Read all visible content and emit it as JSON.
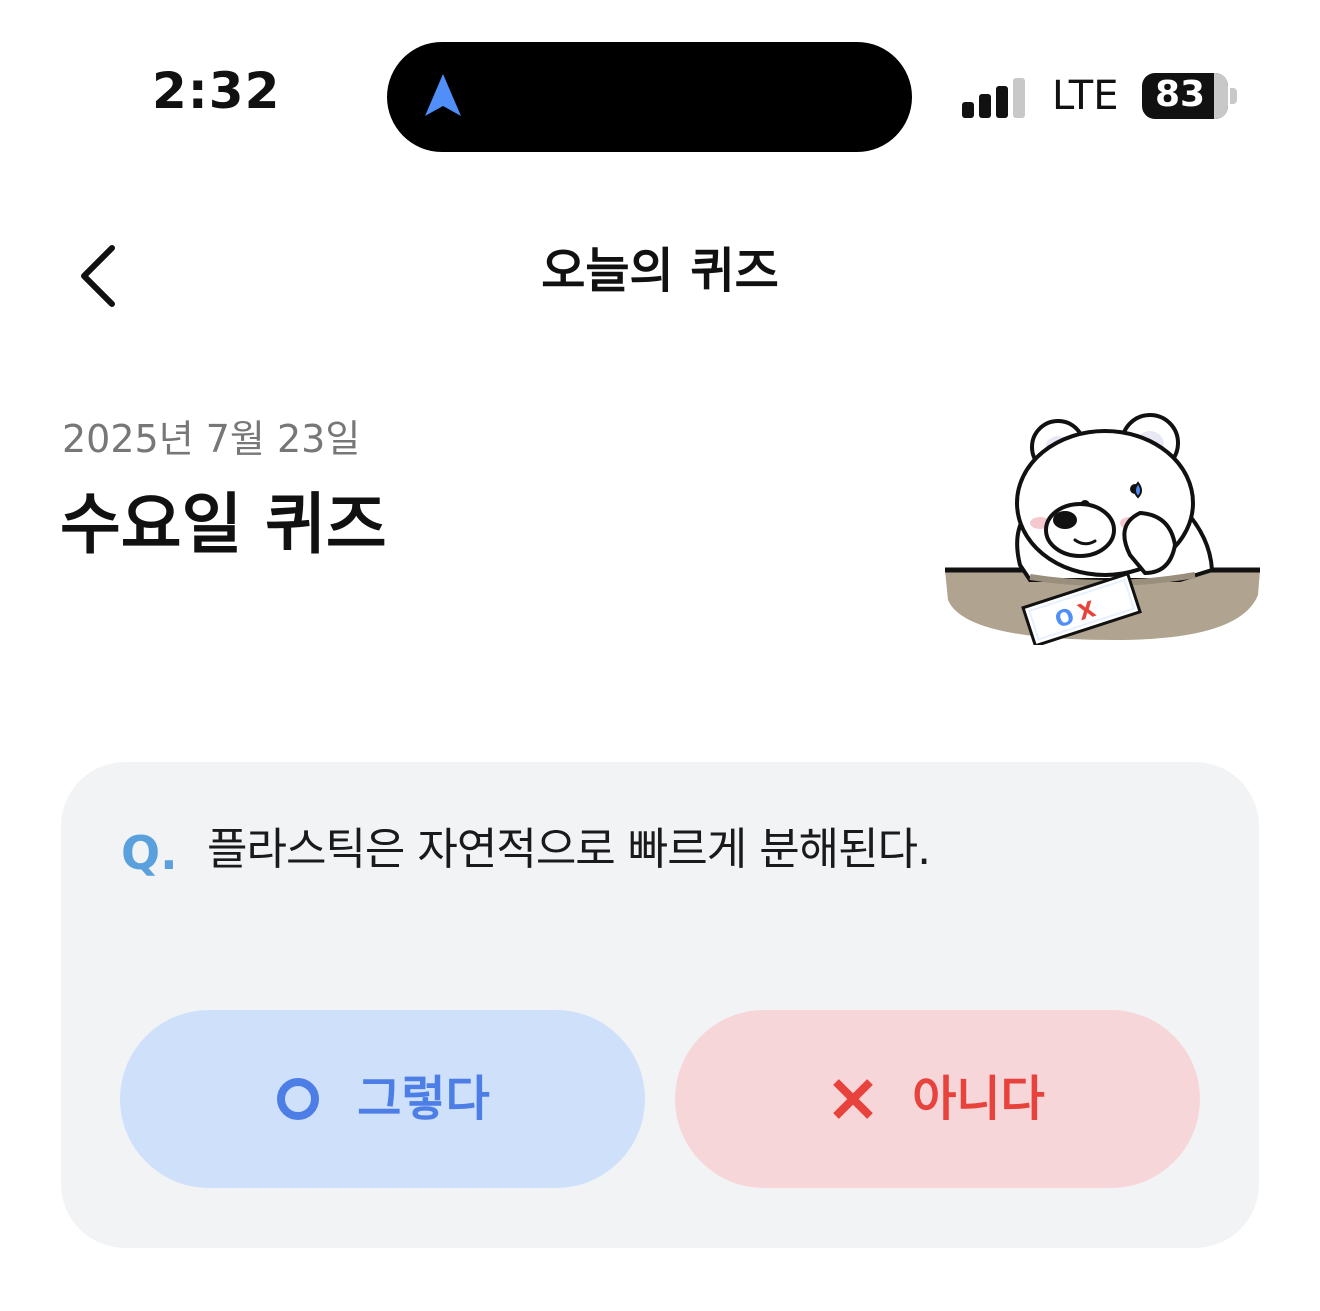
{
  "status_bar": {
    "time": "2:32",
    "network": "LTE",
    "battery": "83",
    "nav_icon": "location-arrow-icon"
  },
  "header": {
    "title": "오늘의 퀴즈",
    "back_icon": "chevron-left-icon"
  },
  "quiz": {
    "date": "2025년 7월 23일",
    "title": "수요일 퀴즈",
    "question_prefix": "Q.",
    "question": "플라스틱은 자연적으로 빠르게 분해된다.",
    "answers": [
      {
        "label": "그렇다",
        "icon": "circle-o-icon",
        "color": "#4d7ee6"
      },
      {
        "label": "아니다",
        "icon": "x-mark-icon",
        "color": "#e8423d"
      }
    ],
    "paper_text": "OX"
  },
  "colors": {
    "yes_bg": "#cfe0fb",
    "no_bg": "#f7d6da",
    "card_bg": "#f2f3f5",
    "q_mark": "#5aa0dd"
  }
}
